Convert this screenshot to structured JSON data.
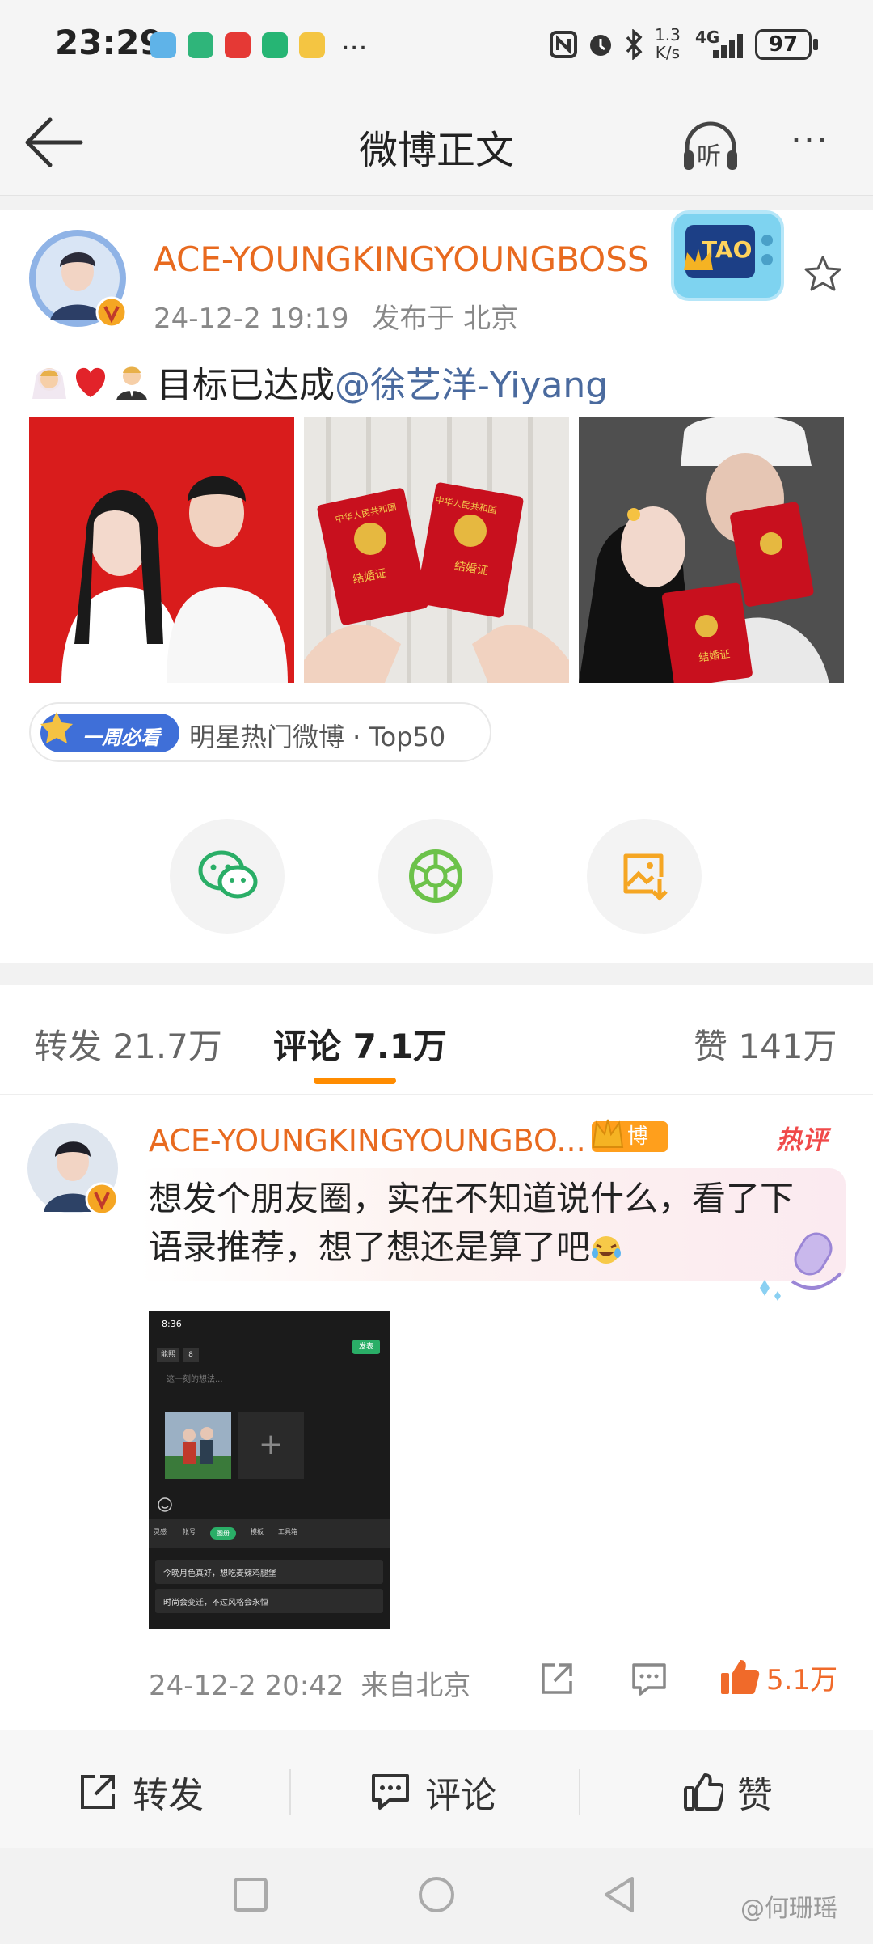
{
  "status_bar": {
    "time": "23:29",
    "more": "...",
    "net_speed_top": "1.3",
    "net_speed_bottom": "K/s",
    "network": "4G",
    "battery": "97"
  },
  "header": {
    "title": "微博正文",
    "listen_label": "听",
    "more": "···"
  },
  "post": {
    "author": "ACE-YOUNGKINGYOUNGBOSS",
    "time": "24-12-2 19:19",
    "location": "发布于 北京",
    "badge_text": "TAO",
    "text_main": "目标已达成",
    "mention": "@徐艺洋-Yiyang",
    "certificate_label": "结婚证",
    "certificate_header": "中华人民共和国",
    "hot_tag_badge": "一周必看",
    "hot_tag_text": "明星热门微博 · Top50"
  },
  "tabs": {
    "repost_label": "转发",
    "repost_count": "21.7万",
    "comment_label": "评论",
    "comment_count": "7.1万",
    "like_label": "赞",
    "like_count": "141万"
  },
  "comment": {
    "author": "ACE-YOUNGKINGYOUNGBO...",
    "role_badge": "博主",
    "hot_label": "热评",
    "text": "想发个朋友圈，实在不知道说什么，看了下语录推荐，想了想还是算了吧",
    "time": "24-12-2 20:42",
    "location": "来自北京",
    "likes": "5.1万",
    "embed": {
      "time": "8:36",
      "publish": "发表",
      "chip1": "能熙",
      "chip2": "8",
      "placeholder": "这一刻的想法...",
      "tools": [
        "灵感",
        "帐号",
        "图册",
        "模板",
        "工具箱"
      ],
      "line1": "今晚月色真好，想吃麦辣鸡腿堡",
      "line2": "时尚会变迁，不过风格会永恒"
    }
  },
  "bottom_bar": {
    "repost": "转发",
    "comment": "评论",
    "like": "赞"
  },
  "watermark": "@何珊瑶",
  "colors": {
    "orange": "#e86a1f",
    "link": "#4a6a9e",
    "wechat_green": "#2aae67",
    "moments_green": "#6cc24a",
    "save_orange": "#f5a623"
  }
}
